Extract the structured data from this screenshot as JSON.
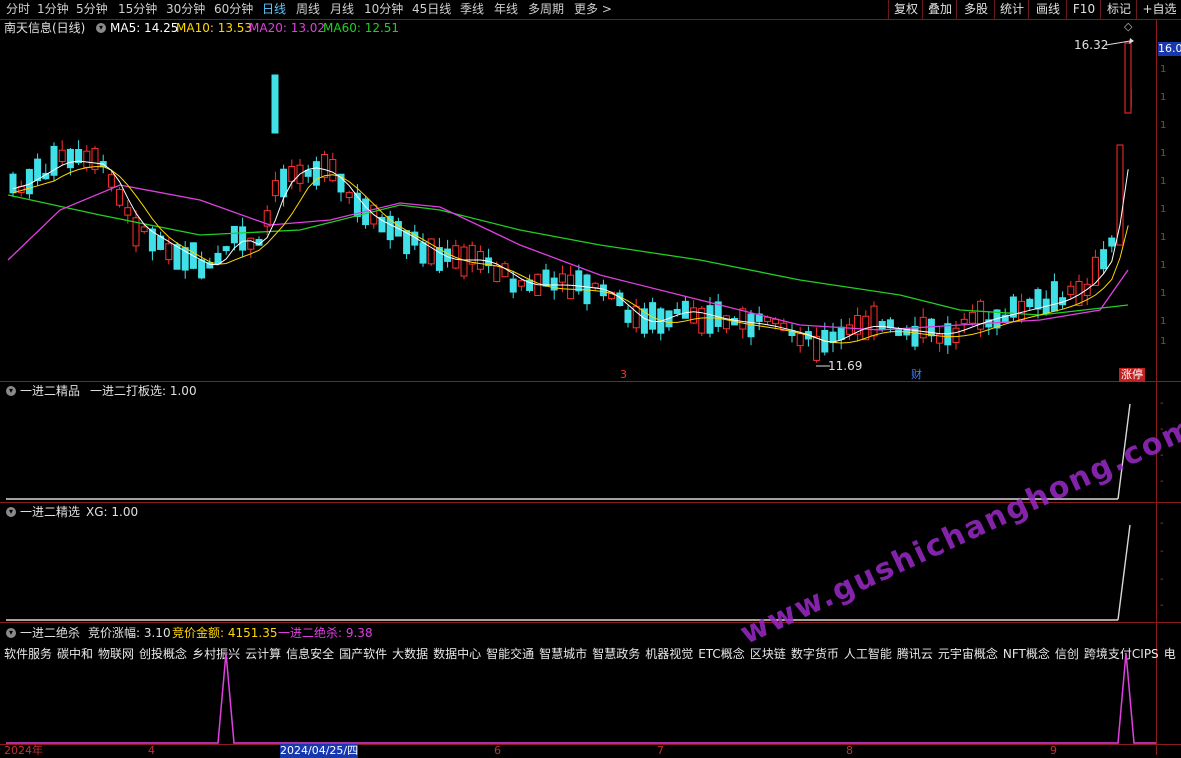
{
  "toolbar": {
    "items": [
      "分时",
      "1分钟",
      "5分钟",
      "15分钟",
      "30分钟",
      "60分钟",
      "日线",
      "周线",
      "月线",
      "10分钟",
      "45日线",
      "季线",
      "年线",
      "多周期",
      "更多 >"
    ],
    "active_index": 6,
    "right_buttons": [
      "复权",
      "叠加",
      "多股",
      "统计",
      "画线",
      "F10",
      "标记",
      "+自选"
    ]
  },
  "main_panel": {
    "stock_title": "南天信息(日线)",
    "ma": [
      {
        "label": "MA5: 14.25",
        "color": "#ffffff"
      },
      {
        "label": "MA10: 13.53",
        "color": "#ffd700"
      },
      {
        "label": "MA20: 13.02",
        "color": "#e040e0"
      },
      {
        "label": "MA60: 12.51",
        "color": "#20d020"
      }
    ],
    "high_label": "16.32",
    "low_label": "11.69",
    "price_badge": "16.0",
    "marker_left": "3",
    "marker_cai": "财",
    "marker_zhangting": "涨停"
  },
  "panel2": {
    "title": "一进二精品",
    "series_label": "一进二打板选: 1.00"
  },
  "panel3": {
    "title": "一进二精选",
    "series_label": "XG: 1.00"
  },
  "panel4": {
    "title": "一进二绝杀",
    "field1": "竞价涨幅: 3.10",
    "field2": "竞价金额: 4151.35",
    "field3": "一进二绝杀: 9.38",
    "colors": {
      "field1": "#e0e0e0",
      "field2": "#ffd700",
      "field3": "#e040e0"
    }
  },
  "sectors": [
    "软件服务",
    "碳中和",
    "物联网",
    "创投概念",
    "乡村振兴",
    "云计算",
    "信息安全",
    "国产软件",
    "大数据",
    "数据中心",
    "智能交通",
    "智慧城市",
    "智慧政务",
    "机器视觉",
    "ETC概念",
    "区块链",
    "数字货币",
    "人工智能",
    "腾讯云",
    "元宇宙概念",
    "NFT概念",
    "信创",
    "跨境支付CIPS",
    "电"
  ],
  "date_axis": {
    "labels": [
      "2024年",
      "4",
      "2024/04/25/四",
      "6",
      "7",
      "8",
      "9"
    ]
  },
  "watermark": "www.gushichanghong.com",
  "colors": {
    "up": "#ff3030",
    "down": "#40e0e8",
    "border": "#8a1c1c",
    "ma5": "#ffffff",
    "ma10": "#ffd700",
    "ma20": "#e040e0",
    "ma60": "#20d020"
  }
}
